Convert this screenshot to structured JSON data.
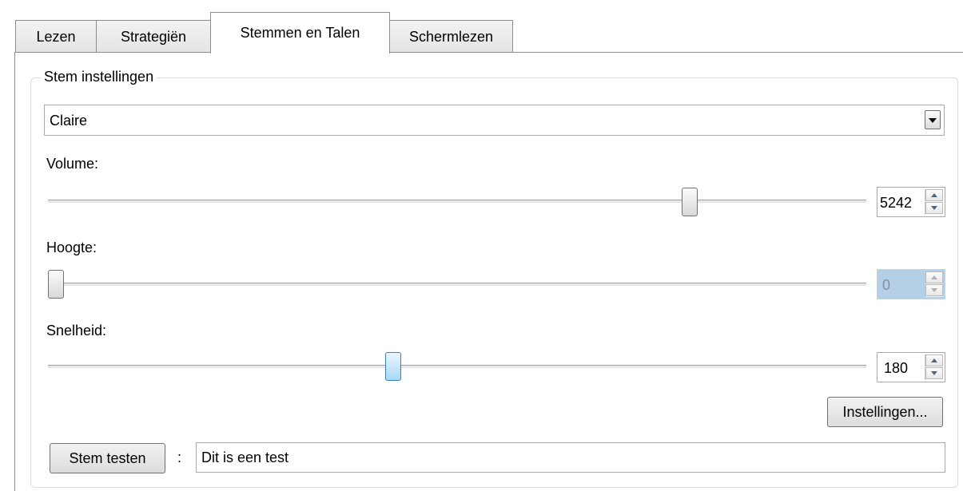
{
  "tabs": [
    {
      "label": "Lezen"
    },
    {
      "label": "Strategiën"
    },
    {
      "label": "Stemmen en Talen"
    },
    {
      "label": "Schermlezen"
    }
  ],
  "voice_settings": {
    "group_title": "Stem instellingen",
    "voice_select": {
      "value": "Claire"
    },
    "volume": {
      "label": "Volume:",
      "value": "5242",
      "slider_fraction": 0.79
    },
    "pitch": {
      "label": "Hoogte:",
      "value": "0",
      "slider_fraction": 0.0,
      "disabled": true
    },
    "speed": {
      "label": "Snelheid:",
      "value": "180",
      "slider_fraction": 0.42
    },
    "settings_button": "Instellingen...",
    "test_button": "Stem testen",
    "test_separator": ":",
    "test_text": "Dit is een test"
  },
  "colors": {
    "tab_border": "#898c95",
    "hot_thumb": "#a7d9f5",
    "disabled_spin": "#b5cfe7"
  }
}
